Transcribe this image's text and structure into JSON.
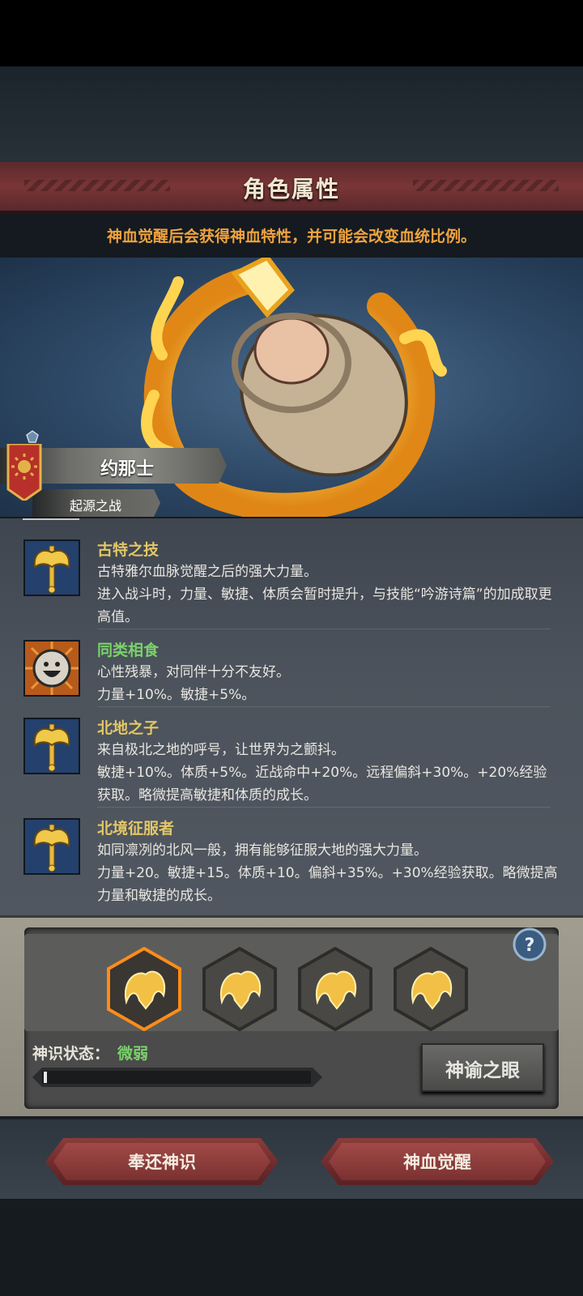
{
  "header": {
    "title": "角色属性"
  },
  "subtitle": "神血觉醒后会获得神血特性，并可能会改变血统比例。",
  "character": {
    "name": "约那士",
    "origin": "起源之战"
  },
  "traits": [
    {
      "name": "古特之技",
      "icon": "golden-axe-icon",
      "color": "gold",
      "desc": [
        "古特雅尔血脉觉醒之后的强大力量。",
        "进入战斗时，力量、敏捷、体质会暂时提升，与技能“吟游诗篇”的加成取更高值。"
      ]
    },
    {
      "name": "同类相食",
      "icon": "smiley-face-icon",
      "color": "green",
      "desc": [
        "心性残暴，对同伴十分不友好。",
        "力量+10%。敏捷+5%。"
      ]
    },
    {
      "name": "北地之子",
      "icon": "golden-axe-icon",
      "color": "gold",
      "desc": [
        "来自极北之地的呼号，让世界为之颤抖。",
        "敏捷+10%。体质+5%。近战命中+20%。远程偏斜+30%。+20%经验获取。略微提高敏捷和体质的成长。"
      ]
    },
    {
      "name": "北境征服者",
      "icon": "golden-axe-icon",
      "color": "gold",
      "desc": [
        "如同凛冽的北风一般，拥有能够征服大地的强大力量。",
        "力量+20。敏捷+15。体质+10。偏斜+35%。+30%经验获取。略微提高力量和敏捷的成长。"
      ]
    }
  ],
  "panel": {
    "status_label": "神识状态：",
    "status_value": "微弱",
    "progress": 0.01,
    "oracle_button": "神谕之眼",
    "help_icon": "question-icon"
  },
  "buttons": {
    "return": "奉还神识",
    "awaken": "神血觉醒"
  },
  "colors": {
    "accent_gold": "#f0a33e",
    "trait_gold": "#e3c766",
    "trait_green": "#7ad26b",
    "header_red": "#7a3537"
  }
}
